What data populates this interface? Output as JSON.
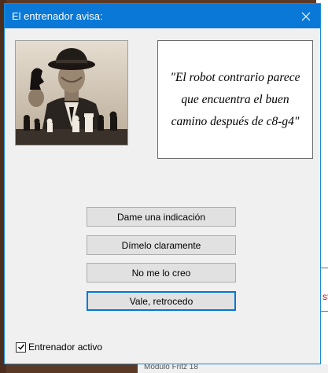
{
  "dialog": {
    "title": "El entrenador avisa:",
    "quote": "\"El robot contrario parece que encuentra el buen camino después de c8-g4\""
  },
  "buttons": {
    "hint": "Dame una indicación",
    "clearly": "Dímelo claramente",
    "disbelieve": "No me lo creo",
    "ok_back": "Vale, retrocedo"
  },
  "coach_toggle": {
    "label": "Entrenador activo",
    "checked": true
  },
  "background": {
    "right_fragment": "st",
    "bottom_fragment": "Módulo Fritz 18"
  },
  "colors": {
    "titlebar": "#0a78d7",
    "default_button_border": "#0078d7"
  }
}
